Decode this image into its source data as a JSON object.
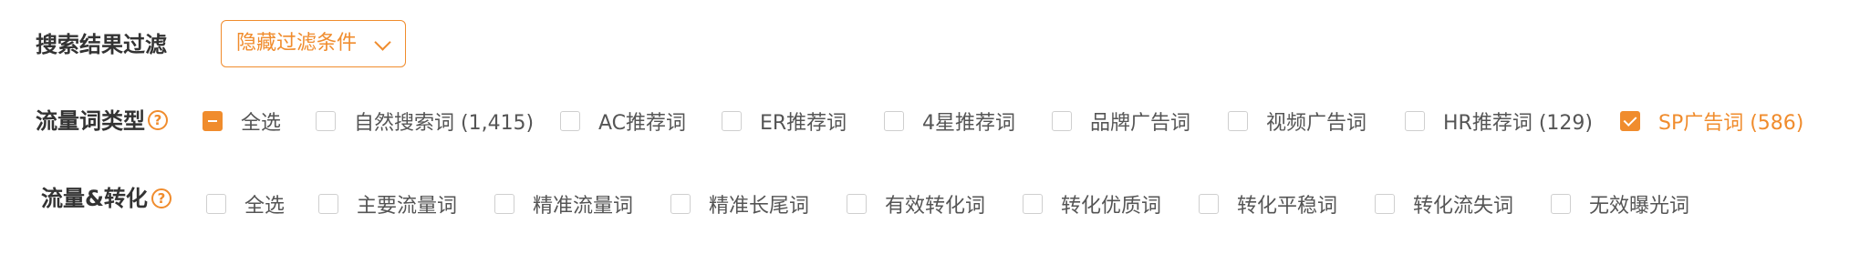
{
  "filter_title": "搜索结果过滤",
  "dropdown": {
    "label": "隐藏过滤条件",
    "icon": "chevron-down-icon"
  },
  "traffic_word_type": {
    "label": "流量词类型",
    "help_icon": "question-circle-icon",
    "help_glyph": "?",
    "options": [
      {
        "label": "全选",
        "state": "indeterminate"
      },
      {
        "label": "自然搜索词 (1,415)",
        "state": "unchecked"
      },
      {
        "label": "AC推荐词",
        "state": "unchecked"
      },
      {
        "label": "ER推荐词",
        "state": "unchecked"
      },
      {
        "label": "4星推荐词",
        "state": "unchecked"
      },
      {
        "label": "品牌广告词",
        "state": "unchecked"
      },
      {
        "label": "视频广告词",
        "state": "unchecked"
      },
      {
        "label": "HR推荐词 (129)",
        "state": "unchecked"
      },
      {
        "label": "SP广告词 (586)",
        "state": "checked"
      }
    ]
  },
  "traffic_conversion": {
    "label": "流量&转化",
    "help_icon": "question-circle-icon",
    "help_glyph": "?",
    "options": [
      {
        "label": "全选",
        "state": "unchecked"
      },
      {
        "label": "主要流量词",
        "state": "unchecked"
      },
      {
        "label": "精准流量词",
        "state": "unchecked"
      },
      {
        "label": "精准长尾词",
        "state": "unchecked"
      },
      {
        "label": "有效转化词",
        "state": "unchecked"
      },
      {
        "label": "转化优质词",
        "state": "unchecked"
      },
      {
        "label": "转化平稳词",
        "state": "unchecked"
      },
      {
        "label": "转化流失词",
        "state": "unchecked"
      },
      {
        "label": "无效曝光词",
        "state": "unchecked"
      }
    ]
  },
  "colors": {
    "accent": "#F08C2D",
    "text": "#555555",
    "label": "#333333",
    "border": "#cfcfcf"
  }
}
